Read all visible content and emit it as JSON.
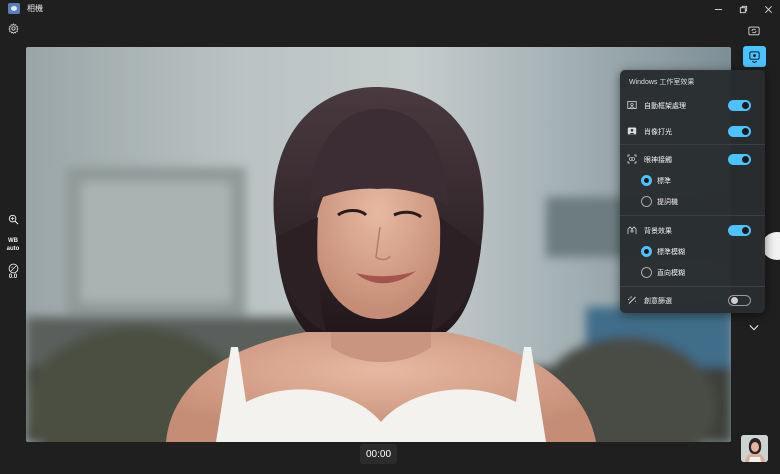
{
  "window": {
    "title": "相機"
  },
  "left_toolbar": {
    "wb_label": "WB",
    "wb_value": "auto",
    "exposure_value": "0.0"
  },
  "timer": "00:00",
  "effects_panel": {
    "title": "Windows 工作室效果",
    "auto_framing": {
      "label": "自動框架處理",
      "enabled": true
    },
    "portrait_light": {
      "label": "肖像打光",
      "enabled": true
    },
    "eye_contact": {
      "label": "眼神接觸",
      "enabled": true,
      "options": [
        {
          "label": "標準",
          "selected": true
        },
        {
          "label": "提詞機",
          "selected": false
        }
      ]
    },
    "background_effects": {
      "label": "背景效果",
      "enabled": true,
      "options": [
        {
          "label": "標準模糊",
          "selected": true
        },
        {
          "label": "直向模糊",
          "selected": false
        }
      ]
    },
    "creative_filters": {
      "label": "創意篩選",
      "enabled": false
    }
  },
  "colors": {
    "accent": "#4cc2ff",
    "panel_bg": "#2c3034",
    "window_bg": "#1f1f1f"
  },
  "icons": [
    "camera-app-icon",
    "minimize-icon",
    "restore-icon",
    "close-icon",
    "settings-gear-icon",
    "zoom-icon",
    "exposure-icon",
    "camera-switch-icon",
    "studio-effects-icon",
    "chevron-down-icon",
    "auto-framing-icon",
    "portrait-light-icon",
    "eye-contact-icon",
    "background-effects-icon",
    "creative-filter-icon"
  ]
}
